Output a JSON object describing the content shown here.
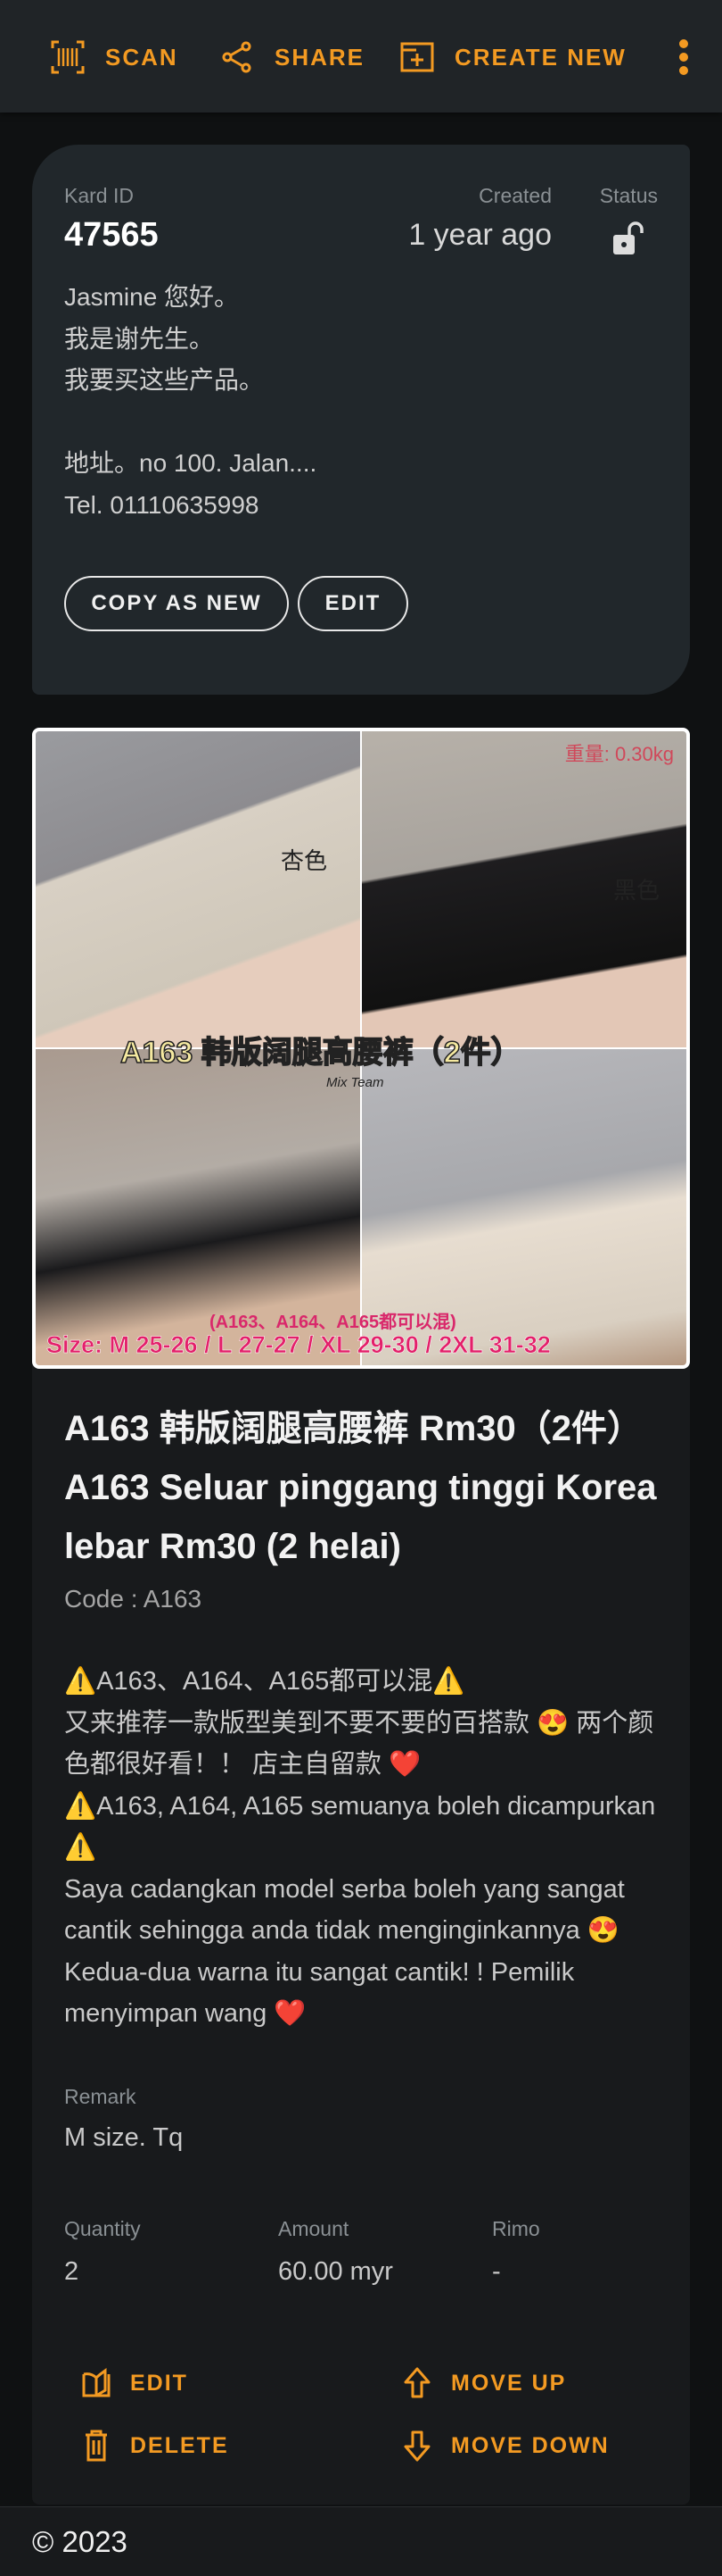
{
  "toolbar": {
    "scan": "SCAN",
    "share": "SHARE",
    "create_new": "CREATE NEW"
  },
  "kard": {
    "id_label": "Kard ID",
    "id": "47565",
    "created_label": "Created",
    "created": "1 year ago",
    "status_label": "Status",
    "status_icon": "lock-open-icon",
    "description": "Jasmine 您好。\n我是谢先生。\n我要买这些产品。\n\n地址。no 100. Jalan....\nTel. 01110635998",
    "copy_as_new": "COPY AS NEW",
    "edit": "EDIT"
  },
  "item": {
    "image_text": {
      "weight": "重量: 0.30kg",
      "color1": "杏色",
      "color2": "黑色",
      "headline": "A163 韩版阔腿高腰裤（2件）",
      "brand": "Mix Team",
      "mix": "(A163、A164、A165都可以混)",
      "size": "Size: M 25-26 / L 27-27 / XL 29-30 / 2XL 31-32"
    },
    "title": "A163 韩版阔腿高腰裤 Rm30（2件） A163 Seluar pinggang tinggi Korea lebar Rm30 (2 helai)",
    "code": "Code : A163",
    "body": "⚠️A163、A164、A165都可以混⚠️\n又来推荐一款版型美到不要不要的百搭款 😍 两个颜色都很好看！！ 店主自留款 ❤️\n⚠️A163, A164, A165 semuanya boleh dicampurkan ⚠️\nSaya cadangkan model serba boleh yang sangat cantik sehingga anda tidak menginginkannya 😍\nKedua-dua warna itu sangat cantik! ! Pemilik menyimpan wang ❤️",
    "remark_label": "Remark",
    "remark": "M size. Tq",
    "quantity_label": "Quantity",
    "quantity": "2",
    "amount_label": "Amount",
    "amount": "60.00 myr",
    "rimo_label": "Rimo",
    "rimo": "-",
    "actions": {
      "edit": "EDIT",
      "delete": "DELETE",
      "move_up": "MOVE UP",
      "move_down": "MOVE DOWN"
    }
  },
  "footer": {
    "copyright": "© 2023"
  },
  "colors": {
    "accent": "#f39a22",
    "card": "#21272b",
    "bg": "#0f1112"
  }
}
